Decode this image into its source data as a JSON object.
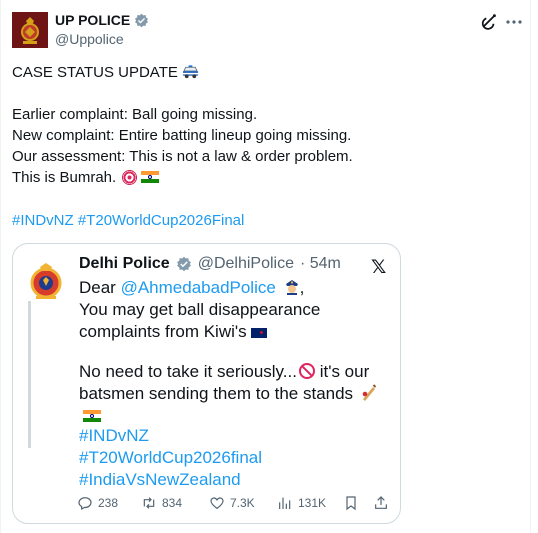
{
  "author": {
    "name": "UP POLICE",
    "handle": "@Uppolice",
    "verified_color": "#829aab"
  },
  "tweet": {
    "line1": "CASE STATUS UPDATE",
    "line1_emoji": "police-car",
    "lines": [
      "Earlier complaint: Ball going missing.",
      "New complaint: Entire batting lineup going missing.",
      "Our assessment: This is not a law & order problem.",
      "This is Bumrah."
    ],
    "last_line_emojis": [
      "direct-hit-target",
      "flag-india"
    ],
    "hashtags": [
      "#INDvNZ",
      "#T20WorldCup2026Final"
    ]
  },
  "quote": {
    "name": "Delhi Police",
    "handle": "@DelhiPolice",
    "time": "· 54m",
    "greeting": "Dear ",
    "mention": "@AhmedabadPolice",
    "after_mention": ",",
    "line2": "You may get ball disappearance",
    "line3": "complaints from Kiwi's",
    "line4": "No need to take it seriously...",
    "line4b": " it's our",
    "line5": "batsmen sending them to the stands",
    "hashtags": [
      "#INDvNZ",
      "#T20WorldCup2026final",
      "#IndiaVsNewZealand"
    ],
    "stats": {
      "replies": "238",
      "reposts": "834",
      "likes": "7.3K",
      "views": "131K"
    }
  },
  "colors": {
    "link": "#1d9bf0",
    "secondary_text": "#536471",
    "border": "#cfd9de"
  }
}
